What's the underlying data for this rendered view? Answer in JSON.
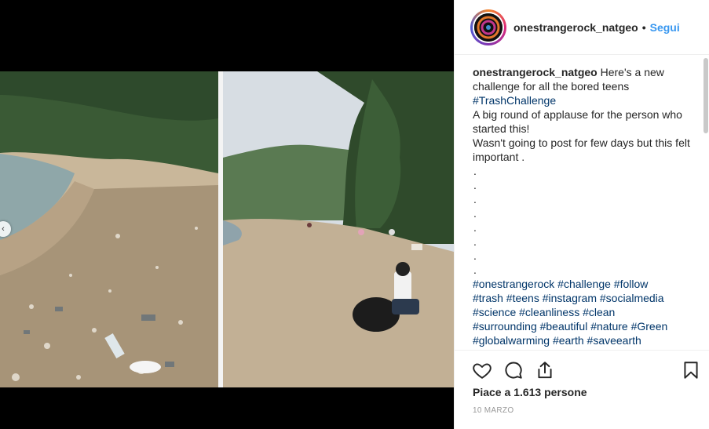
{
  "post": {
    "username": "onestrangerock_natgeo",
    "separator": "•",
    "follow_label": "Segui",
    "caption": {
      "username": "onestrangerock_natgeo",
      "intro": " Here's a new challenge for all the bored teens",
      "hashtag_main": "#TrashChallenge",
      "line2": "A big round of applause for the person who started this!",
      "line3": "Wasn't going to post for few days but this felt important .",
      "dots": [
        ".",
        ".",
        ".",
        ".",
        ".",
        ".",
        ".",
        "."
      ],
      "tags_line1": "#onestrangerock #challenge #follow",
      "tags_line2": "#trash #teens #instagram #socialmedia",
      "tags_line3": "#science #cleanliness #clean",
      "tags_line4": "#surrounding #beautiful #nature #Green",
      "tags_line5": "#globalwarming #earth #saveearth"
    },
    "likes_text": "Piace a 1.613 persone",
    "date_text": "10 MARZO"
  },
  "icons": {
    "like": "heart-icon",
    "comment": "comment-icon",
    "share": "share-icon",
    "save": "bookmark-icon",
    "prev": "chevron-left-icon"
  },
  "colors": {
    "link": "#003569",
    "follow": "#3897f0",
    "text": "#262626",
    "muted": "#999999"
  }
}
